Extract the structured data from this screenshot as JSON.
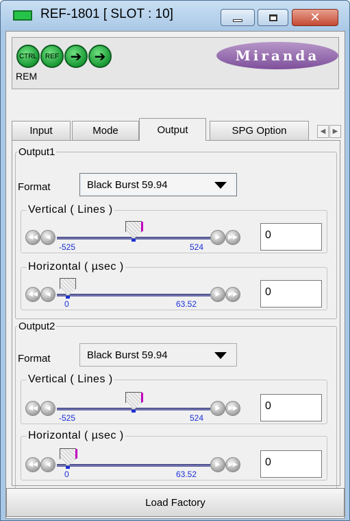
{
  "window": {
    "title": "REF-1801 [ SLOT : 10]",
    "close_glyph": "✕"
  },
  "status": {
    "leds": [
      {
        "label": "CTRL",
        "color": "#1a9a36"
      },
      {
        "label": "REF",
        "color": "#1a9a36"
      },
      {
        "label": "➔",
        "color": "#1a9a36"
      },
      {
        "label": "➔",
        "color": "#1a9a36"
      }
    ],
    "rem_label": "REM",
    "logo_text": "Miranda"
  },
  "tabs": [
    {
      "label": "Input",
      "active": false
    },
    {
      "label": "Mode",
      "active": false
    },
    {
      "label": "Output",
      "active": true
    },
    {
      "label": "SPG Option",
      "active": false
    }
  ],
  "outputs": [
    {
      "legend": "Output1",
      "format_label": "Format",
      "format_value": "Black Burst 59.94",
      "vertical": {
        "legend": "Vertical ( Lines )",
        "min_label": "-525",
        "max_label": "524",
        "value": "0",
        "position_fraction": 0.5
      },
      "horizontal": {
        "legend": "Horizontal ( µsec )",
        "min_label": "0",
        "max_label": "63.52",
        "value": "0",
        "position_fraction": 0.0
      }
    },
    {
      "legend": "Output2",
      "format_label": "Format",
      "format_value": "Black Burst 59.94",
      "vertical": {
        "legend": "Vertical ( Lines )",
        "min_label": "-525",
        "max_label": "524",
        "value": "0",
        "position_fraction": 0.5
      },
      "horizontal": {
        "legend": "Horizontal ( µsec )",
        "min_label": "0",
        "max_label": "63.52",
        "value": "0",
        "position_fraction": 0.0
      }
    }
  ],
  "footer": {
    "load_factory_label": "Load Factory"
  }
}
